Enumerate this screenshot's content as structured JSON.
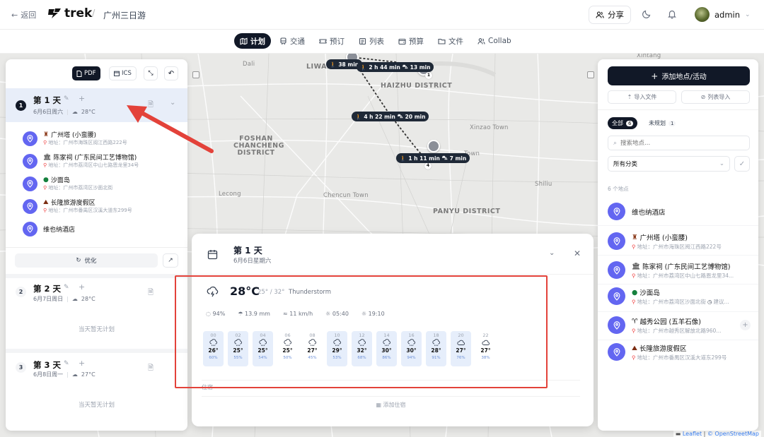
{
  "header": {
    "back_label": "返回",
    "logo_text": "trek",
    "trip_title": "广州三日游",
    "share_label": "分享",
    "user_name": "admin"
  },
  "tabs": [
    {
      "label": "计划",
      "icon": "map-icon",
      "active": true
    },
    {
      "label": "交通",
      "icon": "train-icon"
    },
    {
      "label": "预订",
      "icon": "ticket-icon"
    },
    {
      "label": "列表",
      "icon": "list-icon"
    },
    {
      "label": "预算",
      "icon": "wallet-icon"
    },
    {
      "label": "文件",
      "icon": "folder-icon"
    },
    {
      "label": "Collab",
      "icon": "users-icon"
    }
  ],
  "map": {
    "labels": [
      "Dali",
      "LIWAN",
      "HAIZHU DISTRICT",
      "FOSHAN CHANCHENG DISTRICT",
      "Xinzao Town",
      "Town",
      "Shiliu",
      "Lecong",
      "Chencun Town",
      "PANYU DISTRICT",
      "Xintang"
    ],
    "route_pills": [
      "38 min",
      "2 h 44 min",
      "13 min",
      "4 h 22 min",
      "20 min",
      "1 h 11 min",
      "7 min"
    ],
    "pin_numbers": [
      "1",
      "4"
    ],
    "attribution_leaflet": "Leaflet",
    "attribution_osm": "© OpenStreetMap"
  },
  "left_panel": {
    "toolbar": {
      "pdf": "PDF",
      "ics": "ICS"
    },
    "days": [
      {
        "number": "1",
        "title": "第 1 天",
        "date": "6月6日周六",
        "weather": "28°C",
        "places": [
          {
            "name": "广州塔 (小蛮腰)",
            "emoji_icon": "tower-icon",
            "address": "地址：广州市海珠区阅江西路222号"
          },
          {
            "name": "陈家祠 (广东民间工艺博物馆)",
            "emoji_icon": "temple-icon",
            "address": "地址：广州市荔湾区中山七路恩龙里34号"
          },
          {
            "name": "沙面岛",
            "emoji_icon": "tree-icon",
            "address": "地址：广州市荔湾区沙面北街"
          },
          {
            "name": "长隆旅游度假区",
            "emoji_icon": "roller-coaster-icon",
            "address": "地址：广州市番禺区汉溪大道东299号"
          },
          {
            "name": "维也纳酒店",
            "emoji_icon": "",
            "address": ""
          }
        ],
        "optimize_label": "优化"
      },
      {
        "number": "2",
        "title": "第 2 天",
        "date": "6月7日周日",
        "weather": "28°C",
        "empty": "当天暂无计划"
      },
      {
        "number": "3",
        "title": "第 3 天",
        "date": "6月8日周一",
        "weather": "27°C",
        "empty": "当天暂无计划"
      }
    ]
  },
  "detail_panel": {
    "title": "第 1 天",
    "subtitle": "6月6日星期六",
    "weather": {
      "temp": "28°C",
      "range": "25° / 32°",
      "condition": "Thunderstorm",
      "stats": [
        {
          "icon": "humidity-icon",
          "value": "94%"
        },
        {
          "icon": "rain-icon",
          "value": "13.9 mm"
        },
        {
          "icon": "wind-icon",
          "value": "11 km/h"
        },
        {
          "icon": "sunrise-icon",
          "value": "05:40"
        },
        {
          "icon": "sunset-icon",
          "value": "19:10"
        }
      ],
      "hourly": [
        {
          "time": "00",
          "temp": "26°",
          "precip": "60%",
          "icon": "rain-cloud-icon",
          "highlight": true
        },
        {
          "time": "02",
          "temp": "25°",
          "precip": "55%",
          "icon": "rain-cloud-icon",
          "highlight": true
        },
        {
          "time": "04",
          "temp": "25°",
          "precip": "54%",
          "icon": "rain-cloud-icon",
          "highlight": true
        },
        {
          "time": "06",
          "temp": "25°",
          "precip": "50%",
          "icon": "rain-cloud-icon",
          "highlight": false
        },
        {
          "time": "08",
          "temp": "27°",
          "precip": "45%",
          "icon": "rain-cloud-icon",
          "highlight": false
        },
        {
          "time": "10",
          "temp": "29°",
          "precip": "53%",
          "icon": "rain-cloud-icon",
          "highlight": true
        },
        {
          "time": "12",
          "temp": "32°",
          "precip": "68%",
          "icon": "rain-cloud-icon",
          "highlight": true
        },
        {
          "time": "14",
          "temp": "30°",
          "precip": "86%",
          "icon": "rain-cloud-icon",
          "highlight": true
        },
        {
          "time": "16",
          "temp": "30°",
          "precip": "94%",
          "icon": "rain-cloud-icon",
          "highlight": true
        },
        {
          "time": "18",
          "temp": "28°",
          "precip": "91%",
          "icon": "rain-cloud-icon",
          "highlight": true
        },
        {
          "time": "20",
          "temp": "27°",
          "precip": "76%",
          "icon": "cloud-icon",
          "highlight": true
        },
        {
          "time": "22",
          "temp": "27°",
          "precip": "38%",
          "icon": "cloud-icon",
          "highlight": false
        }
      ]
    },
    "accommodation_label": "住宿",
    "add_accommodation": "添加住宿"
  },
  "right_panel": {
    "add_button": "添加地点/活动",
    "import_file": "导入文件",
    "import_list": "列表导入",
    "filter_all": "全部",
    "filter_all_count": "6",
    "filter_unplanned": "未规划",
    "filter_unplanned_count": "1",
    "search_placeholder": "搜索地点...",
    "category_select": "所有分类",
    "count_label": "6 个地点",
    "places": [
      {
        "name": "维也纳酒店",
        "emoji_icon": "",
        "address": ""
      },
      {
        "name": "广州塔 (小蛮腰)",
        "emoji_icon": "tower-icon",
        "address": "地址：广州市海珠区阅江西路222号"
      },
      {
        "name": "陈家祠 (广东民间工艺博物馆)",
        "emoji_icon": "temple-icon",
        "address": "地址：广州市荔湾区中山七路恩龙里34..."
      },
      {
        "name": "沙面岛",
        "emoji_icon": "tree-icon",
        "address": "地址：广州市荔湾区沙面北街",
        "extra": "建议..."
      },
      {
        "name": "越秀公园 (五羊石像)",
        "emoji_icon": "ram-icon",
        "address": "地址：广州市越秀区解放北路960...",
        "unplanned": true
      },
      {
        "name": "长隆旅游度假区",
        "emoji_icon": "roller-coaster-icon",
        "address": "地址：广州市番禺区汉溪大道东299号"
      }
    ]
  },
  "colors": {
    "accent": "#6366f1",
    "dark": "#111827",
    "annotation": "#e3423a"
  }
}
